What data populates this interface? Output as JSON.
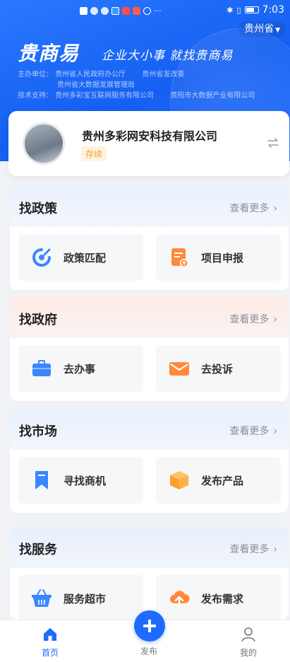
{
  "status_bar": {
    "time": "7:03"
  },
  "header": {
    "region_selector": "贵州省",
    "brand": "贵商易",
    "slogan": "企业大小事  就找贵商易",
    "sponsor_label": "主办单位：",
    "sponsor_1": "贵州省人民政府办公厅",
    "sponsor_2": "贵州省发改委",
    "sponsor_3": "贵州省大数据发展管理局",
    "tech_label": "技术支持：",
    "tech_1": "贵州多彩宝互联网服务有限公司",
    "tech_2": "贵阳市大数据产业有限公司"
  },
  "company": {
    "name": "贵州多彩网安科技有限公司",
    "status": "存续"
  },
  "sections": [
    {
      "title": "找政策",
      "more": "查看更多",
      "tiles": [
        {
          "label": "政策匹配",
          "icon": "policy-match-icon"
        },
        {
          "label": "项目申报",
          "icon": "project-declare-icon"
        }
      ]
    },
    {
      "title": "找政府",
      "more": "查看更多",
      "tiles": [
        {
          "label": "去办事",
          "icon": "briefcase-icon"
        },
        {
          "label": "去投诉",
          "icon": "mail-icon"
        }
      ]
    },
    {
      "title": "找市场",
      "more": "查看更多",
      "tiles": [
        {
          "label": "寻找商机",
          "icon": "bookmark-icon"
        },
        {
          "label": "发布产品",
          "icon": "box-icon"
        }
      ]
    },
    {
      "title": "找服务",
      "more": "查看更多",
      "tiles": [
        {
          "label": "服务超市",
          "icon": "basket-icon"
        },
        {
          "label": "发布需求",
          "icon": "cloud-upload-icon"
        }
      ]
    }
  ],
  "tabbar": {
    "home": "首页",
    "publish": "发布",
    "mine": "我的"
  },
  "colors": {
    "primary": "#1f6bff",
    "badge_text": "#f0a030",
    "badge_bg": "#fff3e0",
    "orange_icon": "#ff8a3d",
    "blue_icon": "#3a86ff"
  }
}
